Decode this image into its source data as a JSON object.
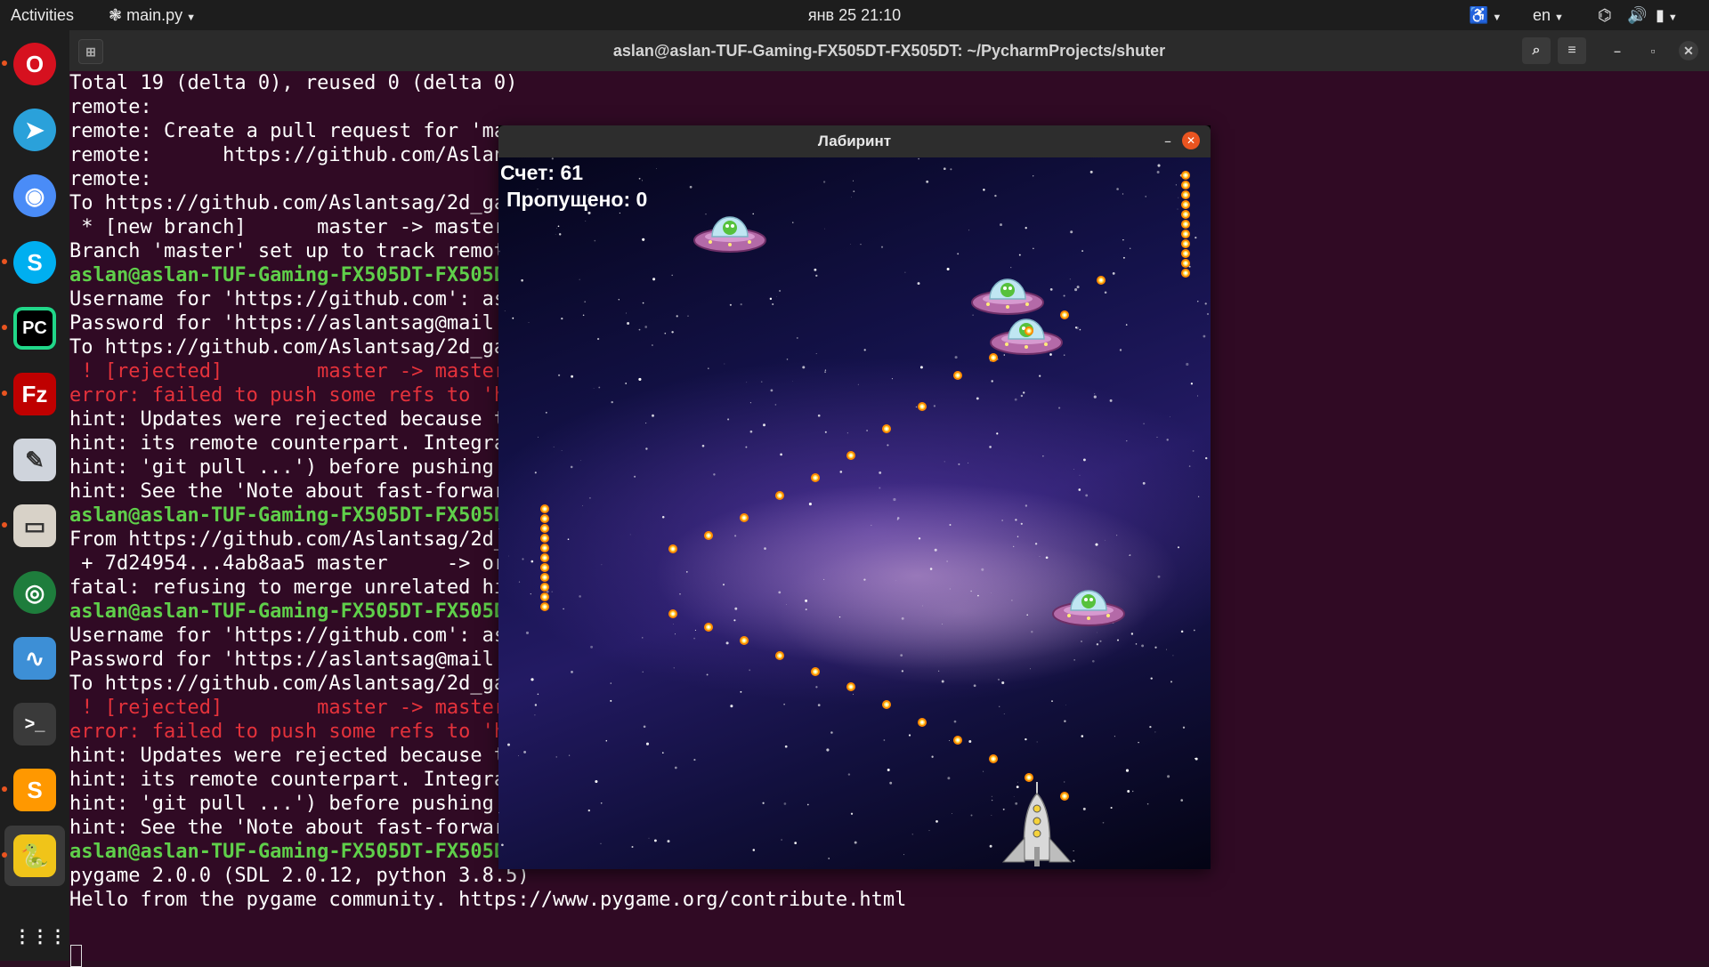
{
  "topbar": {
    "activities": "Activities",
    "app_menu": "main.py",
    "clock": "янв 25  21:10",
    "lang": "en"
  },
  "dock": {
    "items": [
      {
        "name": "opera",
        "icon": "opera-icon",
        "color": "#d6111f"
      },
      {
        "name": "telegram",
        "icon": "telegram-icon",
        "color": "#2aa1da"
      },
      {
        "name": "chromium",
        "icon": "chromium-icon",
        "color": "#4a8cf7"
      },
      {
        "name": "skype",
        "icon": "skype-icon",
        "color": "#00aff0"
      },
      {
        "name": "pycharm",
        "icon": "pycharm-icon",
        "color": "#21d789"
      },
      {
        "name": "filezilla",
        "icon": "filezilla-icon",
        "color": "#bf0000"
      },
      {
        "name": "text-editor",
        "icon": "editor-icon",
        "color": "#cfd4dc"
      },
      {
        "name": "files",
        "icon": "files-icon",
        "color": "#d8d2c8"
      },
      {
        "name": "camera",
        "icon": "camera-icon",
        "color": "#1e7d3c"
      },
      {
        "name": "system-monitor",
        "icon": "monitor-icon",
        "color": "#3d8fd6"
      },
      {
        "name": "terminal",
        "icon": "terminal-icon",
        "color": "#3a3a3a"
      },
      {
        "name": "sublime",
        "icon": "sublime-icon",
        "color": "#ff9800"
      },
      {
        "name": "python-game",
        "icon": "python-game-icon",
        "color": "#f0c419"
      },
      {
        "name": "show-apps",
        "icon": "apps-grid-icon",
        "color": "#1e1e1e"
      }
    ]
  },
  "terminal": {
    "title": "aslan@aslan-TUF-Gaming-FX505DT-FX505DT: ~/PycharmProjects/shuter",
    "lines": [
      {
        "text": "Total 19 (delta 0), reused 0 (delta 0)",
        "style": "normal"
      },
      {
        "text": "remote:",
        "style": "normal"
      },
      {
        "text": "remote: Create a pull request for 'ma",
        "style": "normal"
      },
      {
        "text": "remote:      https://github.com/Aslan",
        "style": "normal"
      },
      {
        "text": "remote:",
        "style": "normal"
      },
      {
        "text": "To https://github.com/Aslantsag/2d_ga",
        "style": "normal"
      },
      {
        "text": " * [new branch]      master -> master",
        "style": "normal"
      },
      {
        "text": "Branch 'master' set up to track remot",
        "style": "normal"
      },
      {
        "text": "aslan@aslan-TUF-Gaming-FX505DT-FX505D",
        "style": "green"
      },
      {
        "text": "Username for 'https://github.com': as",
        "style": "normal"
      },
      {
        "text": "Password for 'https://aslantsag@mail.",
        "style": "normal"
      },
      {
        "text": "To https://github.com/Aslantsag/2d_ga",
        "style": "normal"
      },
      {
        "text": " ! [rejected]        master -> master",
        "style": "red"
      },
      {
        "text": "error: failed to push some refs to 'h",
        "style": "red"
      },
      {
        "text": "hint: Updates were rejected because t",
        "style": "normal"
      },
      {
        "text": "hint: its remote counterpart. Integra",
        "style": "normal"
      },
      {
        "text": "hint: 'git pull ...') before pushing ",
        "style": "normal"
      },
      {
        "text": "hint: See the 'Note about fast-forwar",
        "style": "normal"
      },
      {
        "text": "aslan@aslan-TUF-Gaming-FX505DT-FX505D",
        "style": "green"
      },
      {
        "text": "From https://github.com/Aslantsag/2d_",
        "style": "normal"
      },
      {
        "text": " + 7d24954...4ab8aa5 master     -> or",
        "style": "normal"
      },
      {
        "text": "fatal: refusing to merge unrelated hi",
        "style": "normal"
      },
      {
        "text": "aslan@aslan-TUF-Gaming-FX505DT-FX505D",
        "style": "green"
      },
      {
        "text": "Username for 'https://github.com': as",
        "style": "normal"
      },
      {
        "text": "Password for 'https://aslantsag@mail.",
        "style": "normal"
      },
      {
        "text": "To https://github.com/Aslantsag/2d_ga",
        "style": "normal"
      },
      {
        "text": " ! [rejected]        master -> master",
        "style": "red"
      },
      {
        "text": "error: failed to push some refs to 'h",
        "style": "red"
      },
      {
        "text": "hint: Updates were rejected because t",
        "style": "normal"
      },
      {
        "text": "hint: its remote counterpart. Integra",
        "style": "normal"
      },
      {
        "text": "hint: 'git pull ...') before pushing ",
        "style": "normal"
      },
      {
        "text": "hint: See the 'Note about fast-forwar",
        "style": "normal"
      },
      {
        "text": "aslan@aslan-TUF-Gaming-FX505DT-FX505D",
        "style": "green"
      },
      {
        "text": "pygame 2.0.0 (SDL 2.0.12, python 3.8.5)",
        "style": "normal"
      },
      {
        "text": "Hello from the pygame community. https://www.pygame.org/contribute.html",
        "style": "normal"
      }
    ]
  },
  "game": {
    "title": "Лабиринт",
    "score_text": "Счет: 61",
    "missed_text": "Пропущено: 0"
  }
}
